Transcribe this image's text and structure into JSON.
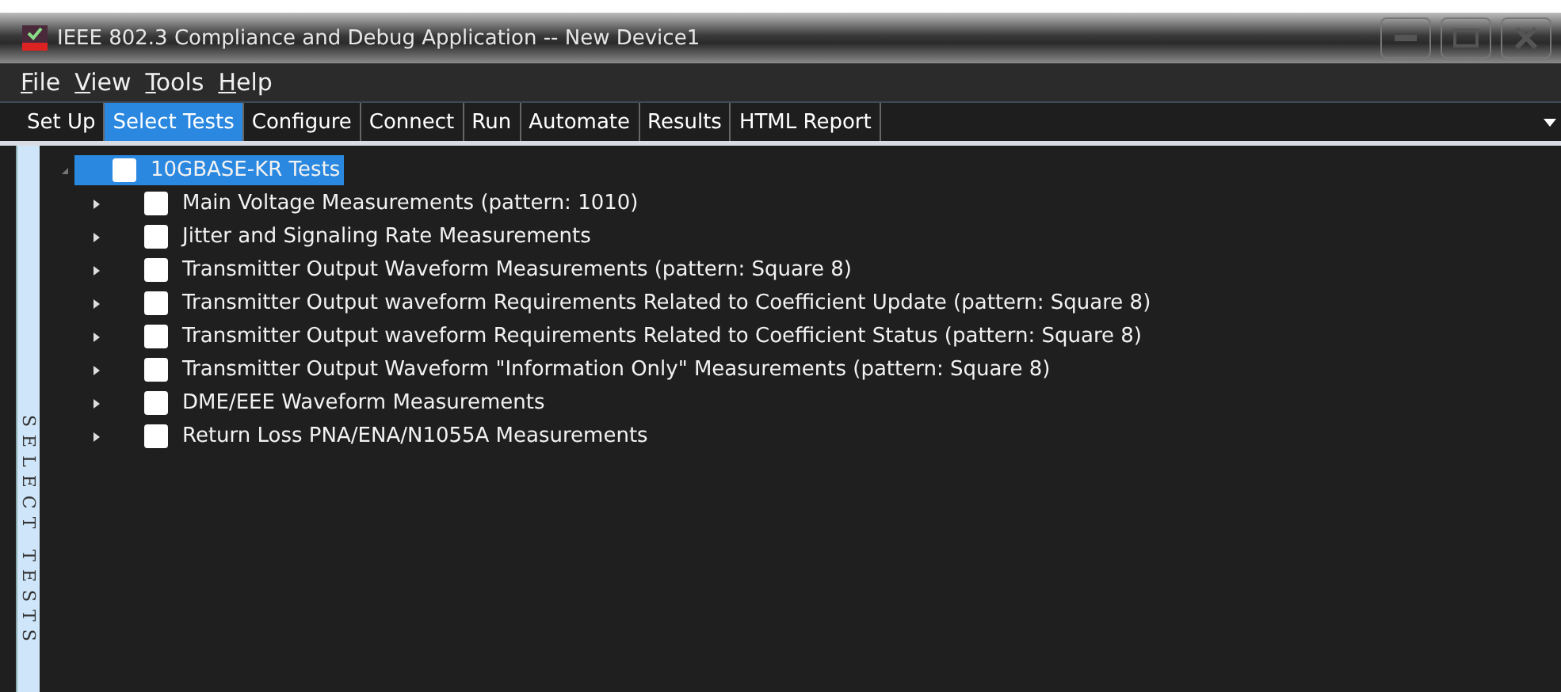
{
  "window": {
    "title": "IEEE 802.3 Compliance and Debug Application -- New Device1"
  },
  "menu": [
    "File",
    "View",
    "Tools",
    "Help"
  ],
  "tabs": [
    {
      "label": "Set Up",
      "selected": false
    },
    {
      "label": "Select Tests",
      "selected": true
    },
    {
      "label": "Configure",
      "selected": false
    },
    {
      "label": "Connect",
      "selected": false
    },
    {
      "label": "Run",
      "selected": false
    },
    {
      "label": "Automate",
      "selected": false
    },
    {
      "label": "Results",
      "selected": false
    },
    {
      "label": "HTML Report",
      "selected": false
    }
  ],
  "side_label": "SELECT TESTS",
  "tree": {
    "label": "10GBASE-KR Tests",
    "checked": false,
    "expanded": true,
    "selected": true,
    "children": [
      {
        "label": "Main Voltage Measurements (pattern: 1010)",
        "checked": false,
        "expanded": false
      },
      {
        "label": "Jitter and Signaling Rate Measurements",
        "checked": false,
        "expanded": false
      },
      {
        "label": "Transmitter Output Waveform Measurements (pattern: Square 8)",
        "checked": false,
        "expanded": false
      },
      {
        "label": "Transmitter Output waveform Requirements Related to Coefficient Update (pattern: Square 8)",
        "checked": false,
        "expanded": false
      },
      {
        "label": "Transmitter Output waveform Requirements Related to Coefficient Status (pattern: Square 8)",
        "checked": false,
        "expanded": false
      },
      {
        "label": "Transmitter Output Waveform \"Information Only\" Measurements (pattern: Square 8)",
        "checked": false,
        "expanded": false
      },
      {
        "label": "DME/EEE Waveform Measurements",
        "checked": false,
        "expanded": false
      },
      {
        "label": "Return Loss PNA/ENA/N1055A Measurements",
        "checked": false,
        "expanded": false
      }
    ]
  }
}
